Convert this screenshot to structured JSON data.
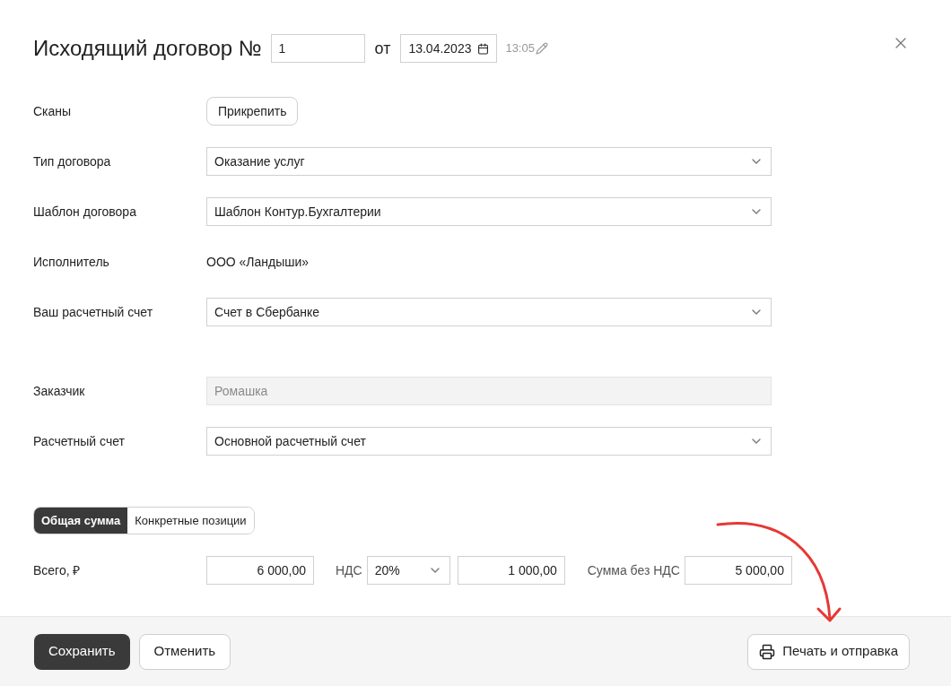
{
  "header": {
    "title": "Исходящий договор №",
    "number": "1",
    "date_prefix": "от",
    "date": "13.04.2023",
    "time": "13:05"
  },
  "contractor_rows": [
    {
      "label": "Сканы",
      "kind": "button",
      "value": "Прикрепить"
    },
    {
      "label": "Тип договора",
      "kind": "select",
      "value": "Оказание услуг"
    },
    {
      "label": "Шаблон договора",
      "kind": "select",
      "value": "Шаблон Контур.Бухгалтерии"
    },
    {
      "label": "Исполнитель",
      "kind": "text",
      "value": "ООО «Ландыши»"
    },
    {
      "label": "Ваш расчетный счет",
      "kind": "select",
      "value": "Счет в Сбербанке"
    }
  ],
  "customer_rows": [
    {
      "label": "Заказчик",
      "kind": "readonly",
      "value": "Ромашка"
    },
    {
      "label": "Расчетный счет",
      "kind": "select",
      "value": "Основной расчетный счет"
    }
  ],
  "sum_tabs": [
    {
      "label": "Общая сумма",
      "selected": true
    },
    {
      "label": "Конкретные позиции",
      "selected": false
    }
  ],
  "totals": {
    "label": "Всего, ₽",
    "total": "6 000,00",
    "vat_label": "НДС",
    "vat_rate": "20%",
    "vat_amount": "1 000,00",
    "net_label": "Сумма без НДС",
    "net": "5 000,00"
  },
  "footer": {
    "save": "Сохранить",
    "cancel": "Отменить",
    "print": "Печать и отправка"
  }
}
